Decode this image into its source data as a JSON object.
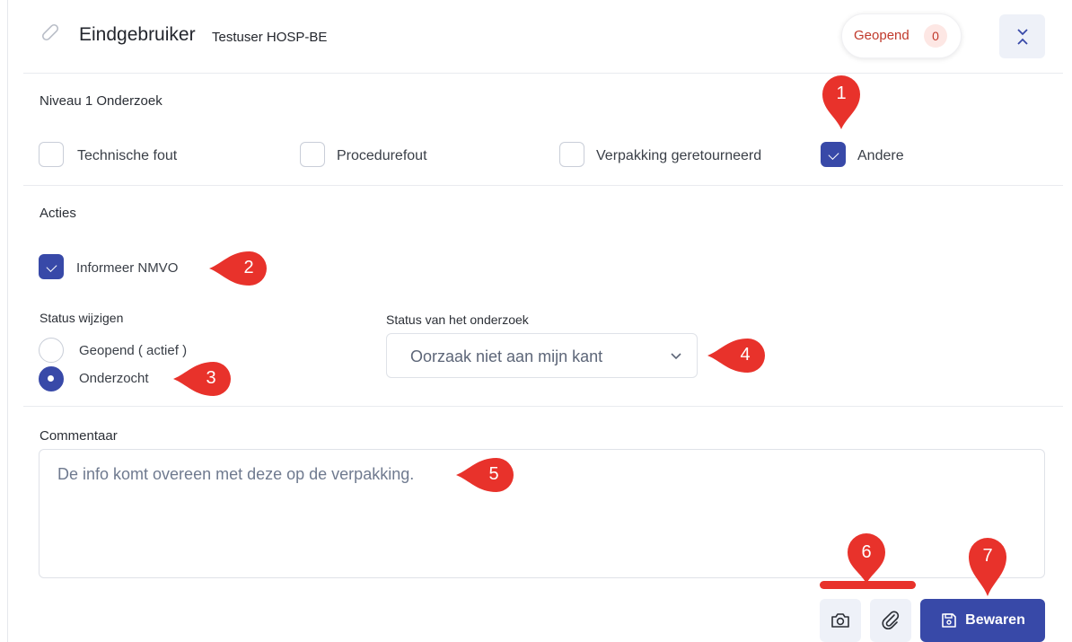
{
  "header": {
    "icon": "link-icon",
    "title": "Eindgebruiker",
    "subtitle": "Testuser HOSP-BE",
    "status_label": "Geopend",
    "status_count": "0",
    "collapse_icon": "collapse-chevrons-icon"
  },
  "niveau": {
    "label": "Niveau 1 Onderzoek",
    "options": [
      {
        "label": "Technische fout",
        "checked": false
      },
      {
        "label": "Procedurefout",
        "checked": false
      },
      {
        "label": "Verpakking geretourneerd",
        "checked": false
      },
      {
        "label": "Andere",
        "checked": true
      }
    ]
  },
  "acties": {
    "label": "Acties",
    "inform_label": "Informeer NMVO",
    "inform_checked": true
  },
  "status": {
    "change_label": "Status wijzigen",
    "options": [
      {
        "label": "Geopend ( actief )",
        "selected": false
      },
      {
        "label": "Onderzocht",
        "selected": true
      }
    ],
    "investigation_label": "Status van het onderzoek",
    "investigation_value": "Oorzaak niet aan mijn kant"
  },
  "comment": {
    "label": "Commentaar",
    "value": "De info komt overeen met deze op de verpakking."
  },
  "footer": {
    "camera_icon": "camera-icon",
    "attach_icon": "paperclip-icon",
    "save_icon": "save-icon",
    "save_label": "Bewaren"
  },
  "callouts": [
    "1",
    "2",
    "3",
    "4",
    "5",
    "6",
    "7"
  ],
  "colors": {
    "accent": "#3849a8",
    "status_red": "#c0392b",
    "callout_red": "#e8322b"
  }
}
